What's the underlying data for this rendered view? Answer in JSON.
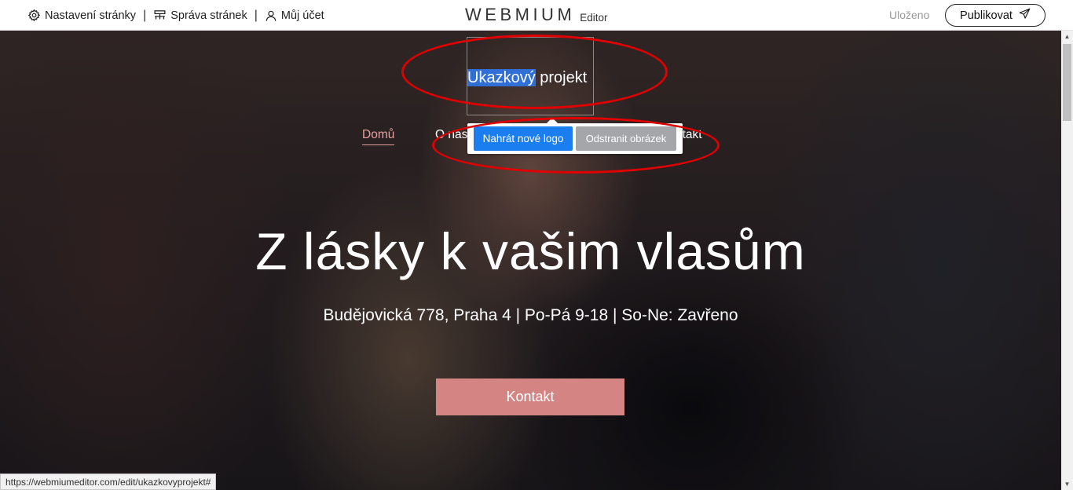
{
  "editor": {
    "brand_name": "WEBMIUM",
    "brand_sub": "Editor",
    "menu": [
      {
        "label": "Nastavení stránky",
        "icon": "gear-icon"
      },
      {
        "label": "Správa stránek",
        "icon": "pages-icon"
      },
      {
        "label": "Můj účet",
        "icon": "user-icon"
      }
    ],
    "separator": "|",
    "status": "Uloženo",
    "publish_label": "Publikovat"
  },
  "site": {
    "logo_selected": "Ukazkový",
    "logo_rest": " projekt",
    "nav": {
      "home": "Domů",
      "about": "O nás",
      "contact": "ntakt"
    },
    "popover": {
      "upload_label": "Nahrát nové logo",
      "remove_label": "Odstranit obrázek"
    },
    "headline": "Z lásky k vašim vlasům",
    "subline": "Budějovická 778, Praha 4 | Po-Pá 9-18 | So-Ne: Zavřeno",
    "cta_label": "Kontakt"
  },
  "browser": {
    "status_url": "https://webmiumeditor.com/edit/ukazkovyprojekt#"
  },
  "colors": {
    "accent_pink": "#d58484",
    "primary_blue": "#1a7ef0",
    "annotation_red": "#e00000"
  }
}
